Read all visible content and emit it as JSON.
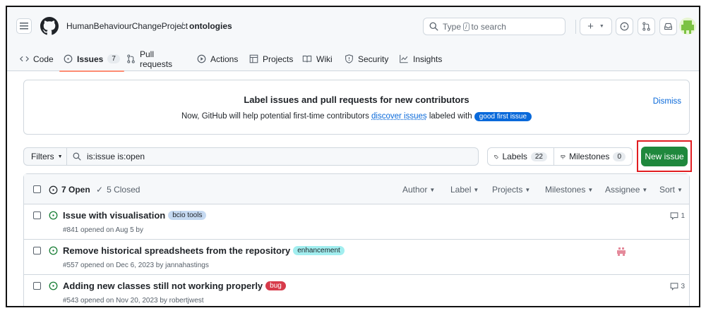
{
  "header": {
    "owner": "HumanBehaviourChangeProject",
    "separator": "/",
    "repo": "ontologies",
    "search_prefix": "Type",
    "search_key": "/",
    "search_suffix": "to search",
    "plus": "+"
  },
  "nav": {
    "tabs": [
      {
        "label": "Code"
      },
      {
        "label": "Issues",
        "count": "7"
      },
      {
        "label": "Pull requests"
      },
      {
        "label": "Actions"
      },
      {
        "label": "Projects"
      },
      {
        "label": "Wiki"
      },
      {
        "label": "Security"
      },
      {
        "label": "Insights"
      }
    ]
  },
  "banner": {
    "title": "Label issues and pull requests for new contributors",
    "text_before": "Now, GitHub will help potential first-time contributors",
    "link": "discover issues",
    "text_after": "labeled with",
    "label": "good first issue",
    "dismiss": "Dismiss"
  },
  "toolbar": {
    "filters": "Filters",
    "query": "is:issue is:open",
    "labels": "Labels",
    "labels_count": "22",
    "milestones": "Milestones",
    "milestones_count": "0",
    "new_issue": "New issue"
  },
  "list": {
    "open": "7 Open",
    "closed": "5 Closed",
    "sorts": [
      "Author",
      "Label",
      "Projects",
      "Milestones",
      "Assignee",
      "Sort"
    ],
    "issues": [
      {
        "title": "Issue with visualisation",
        "label": "bcio tools",
        "meta": "#841 opened on Aug 5 by",
        "comments": "1"
      },
      {
        "title": "Remove historical spreadsheets from the repository",
        "label": "enhancement",
        "meta": "#557 opened on Dec 6, 2023 by jannahastings",
        "comments": ""
      },
      {
        "title": "Adding new classes still not working properly",
        "label": "bug",
        "meta": "#543 opened on Nov 20, 2023 by robertjwest",
        "comments": "3"
      }
    ]
  },
  "colors": {
    "accent": "#0969da",
    "new_issue_bg": "#1f883d",
    "highlight_box": "#e11d21",
    "open_icon": "#1a7f37",
    "label_bcio": "#c5d9f1",
    "label_enhancement": "#a2eeef",
    "label_bug": "#d73a4a"
  }
}
